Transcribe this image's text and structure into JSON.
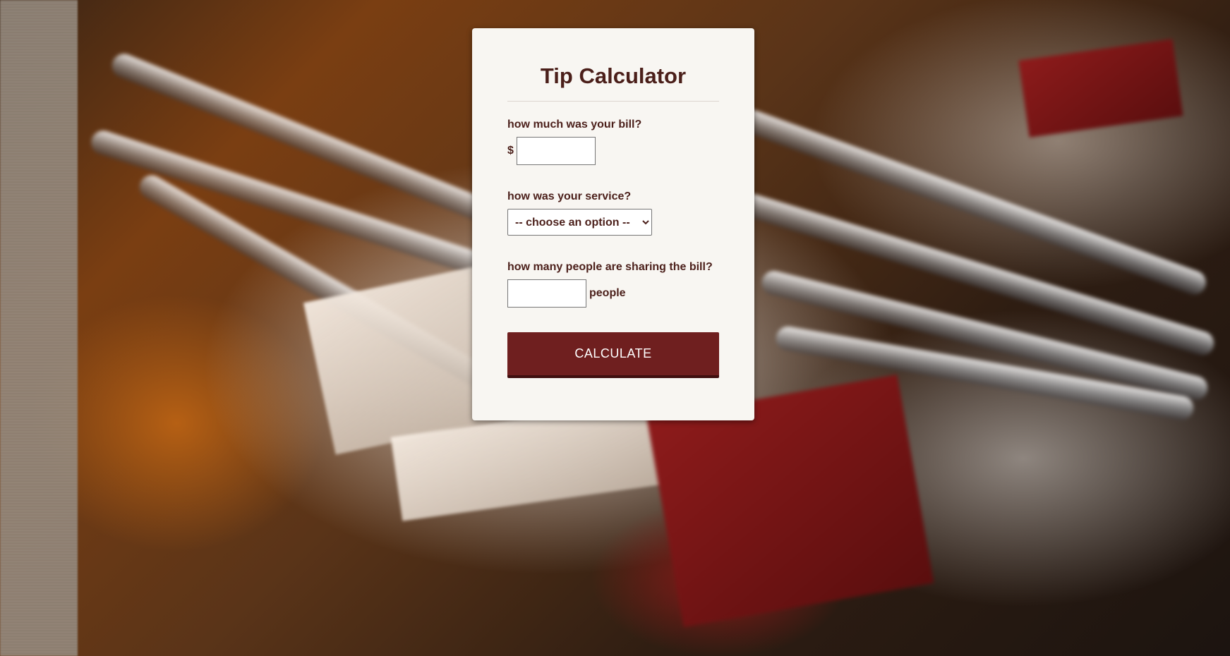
{
  "app": {
    "title": "Tip Calculator"
  },
  "form": {
    "bill_label": "how much was your bill?",
    "currency_symbol": "$",
    "bill_value": "",
    "service_label": "how was your service?",
    "service_selected": "-- choose an option --",
    "service_options": [
      "-- choose an option --"
    ],
    "people_label": "how many people are sharing the bill?",
    "people_value": "",
    "people_suffix": "people",
    "calculate_label": "CALCULATE"
  },
  "colors": {
    "text_primary": "#4b1f1a",
    "button_bg": "#6f1f1f",
    "card_bg": "#f8f6f2"
  },
  "icons": {
    "select_arrow": "chevron-down-icon"
  }
}
